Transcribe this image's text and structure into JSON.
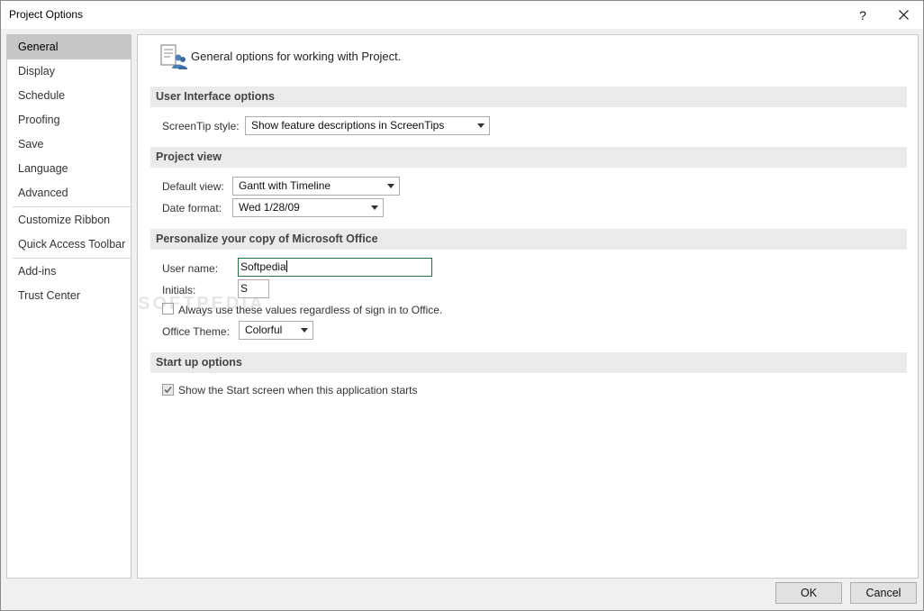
{
  "window": {
    "title": "Project Options",
    "help_glyph": "?",
    "close_icon": "close-icon"
  },
  "sidebar": {
    "items": [
      {
        "label": "General",
        "selected": true
      },
      {
        "label": "Display"
      },
      {
        "label": "Schedule"
      },
      {
        "label": "Proofing"
      },
      {
        "label": "Save"
      },
      {
        "label": "Language"
      },
      {
        "label": "Advanced"
      },
      {
        "label": "Customize Ribbon"
      },
      {
        "label": "Quick Access Toolbar"
      },
      {
        "label": "Add-ins"
      },
      {
        "label": "Trust Center"
      }
    ]
  },
  "header": {
    "icon": "general-options-icon",
    "text": "General options for working with Project."
  },
  "sections": {
    "ui": {
      "title": "User Interface options",
      "screentip_label": "ScreenTip style:",
      "screentip_value": "Show feature descriptions in ScreenTips"
    },
    "project_view": {
      "title": "Project view",
      "default_view_label": "Default view:",
      "default_view_value": "Gantt with Timeline",
      "date_format_label": "Date format:",
      "date_format_value": "Wed 1/28/09"
    },
    "personalize": {
      "title": "Personalize your copy of Microsoft Office",
      "user_name_label": "User name:",
      "user_name_value": "Softpedia",
      "initials_label": "Initials:",
      "initials_value": "S",
      "always_use_label": "Always use these values regardless of sign in to Office.",
      "always_use_checked": false,
      "office_theme_label": "Office Theme:",
      "office_theme_value": "Colorful"
    },
    "startup": {
      "title": "Start up options",
      "show_start_label": "Show the Start screen when this application starts",
      "show_start_checked": true
    }
  },
  "watermark": "SOFTPEDIA",
  "footer": {
    "ok_label": "OK",
    "cancel_label": "Cancel"
  },
  "colors": {
    "focus_border": "#217346",
    "selected_nav": "#c6c6c6"
  }
}
